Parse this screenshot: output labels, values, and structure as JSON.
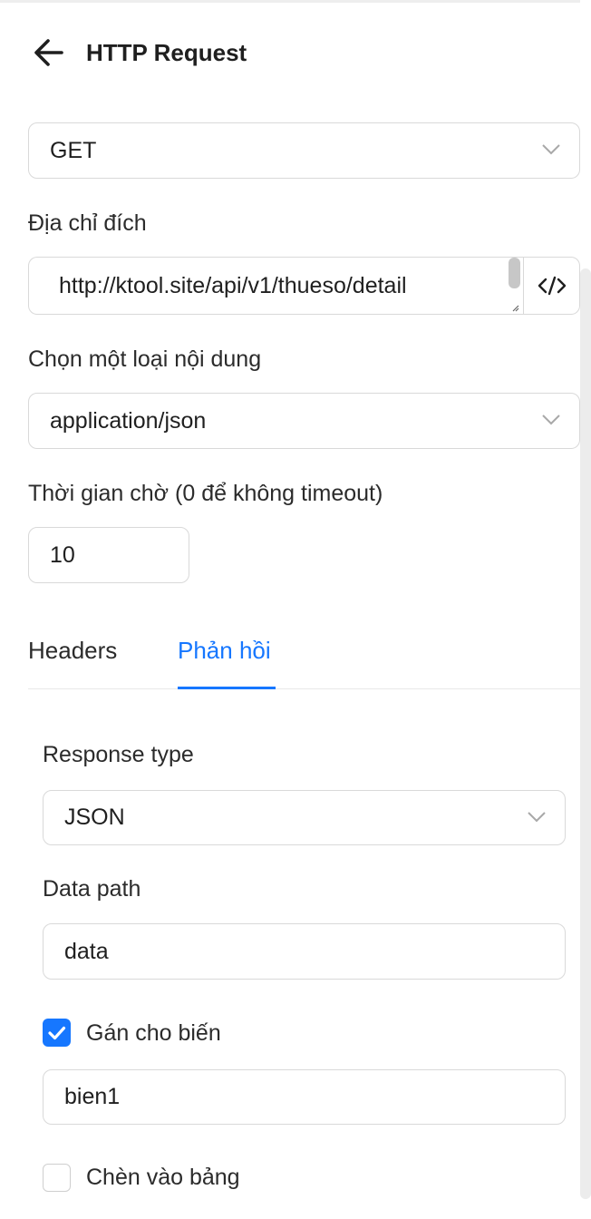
{
  "header": {
    "title": "HTTP Request",
    "back_icon": "arrow-left-icon"
  },
  "method": {
    "value": "GET"
  },
  "url": {
    "label": "Địa chỉ đích",
    "value": "http://ktool.site/api/v1/thueso/detail",
    "code_icon": "code-icon"
  },
  "content_type": {
    "label": "Chọn một loại nội dung",
    "value": "application/json"
  },
  "timeout": {
    "label": "Thời gian chờ (0 để không timeout)",
    "value": "10"
  },
  "tabs": [
    {
      "label": "Headers",
      "active": false
    },
    {
      "label": "Phản hồi",
      "active": true
    }
  ],
  "response": {
    "type_label": "Response type",
    "type_value": "JSON",
    "data_path_label": "Data path",
    "data_path_value": "data",
    "assign": {
      "label": "Gán cho biến",
      "checked": true,
      "value": "bien1"
    },
    "insert_table": {
      "label": "Chèn vào bảng",
      "checked": false
    }
  },
  "colors": {
    "accent": "#1677ff",
    "border": "#d9d9d9",
    "text": "#1f1f1f"
  }
}
